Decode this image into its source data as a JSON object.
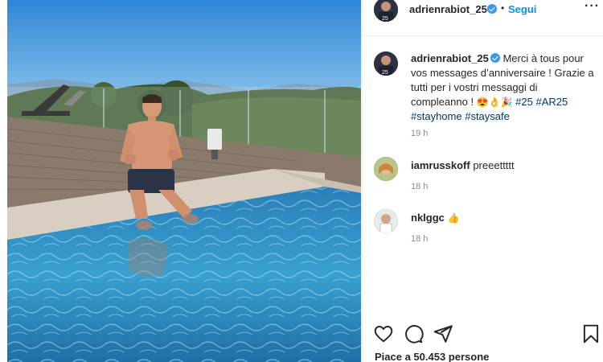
{
  "post": {
    "username": "adrienrabiot_25",
    "follow_label": "Segui",
    "separator": "•",
    "more_label": "···",
    "caption": {
      "username": "adrienrabiot_25",
      "text_fr": "Merci à tous pour vos messages d’anniversaire ! Grazie a tutti per i vostri messaggi di compleanno !",
      "emojis": "😍👌🎉",
      "hashtags": [
        "#25",
        "#AR25",
        "#stayhome",
        "#staysafe"
      ],
      "time": "19 h"
    },
    "comments": [
      {
        "username": "iamrusskoff",
        "text": "preeettttt",
        "emoji": "",
        "time": "18 h"
      },
      {
        "username": "nklggc",
        "text": "",
        "emoji": "👍",
        "time": "18 h"
      }
    ],
    "likes_text": "Piace a 50.453 persone",
    "icons": [
      "heart-icon",
      "comment-icon",
      "share-icon",
      "bookmark-icon",
      "verified-icon",
      "more-icon"
    ]
  },
  "colors": {
    "follow_blue": "#0095f6",
    "verified_blue": "#3897f0",
    "hashtag": "#00376b",
    "time_gray": "#8e8e8e",
    "pool_water": "#2f8fc4",
    "sky": "#3b8fd8"
  }
}
